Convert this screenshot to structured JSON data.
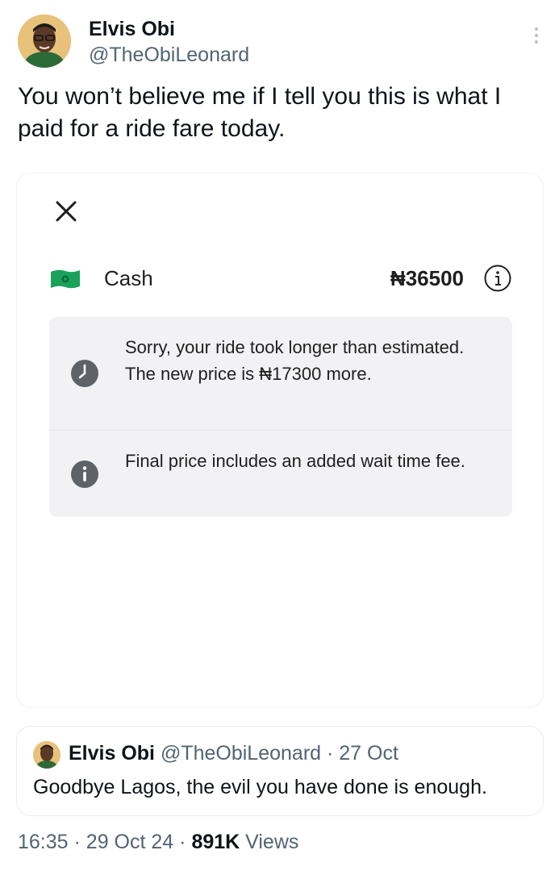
{
  "tweet": {
    "author": {
      "name": "Elvis Obi",
      "handle": "@TheObiLeonard"
    },
    "text": "You won’t believe me if I tell you this is what I paid for a ride fare today.",
    "icons": {
      "more": "more-vertical-icon"
    }
  },
  "receipt": {
    "icons": {
      "close": "close-icon",
      "cash": "cash-icon",
      "info": "info-icon",
      "clock": "clock-icon"
    },
    "payment_method": "Cash",
    "price": "₦36500",
    "notices": [
      {
        "icon": "clock-icon",
        "text": "Sorry, your ride took longer than estimated. The new price is ₦17300 more."
      },
      {
        "icon": "info-icon",
        "text": "Final price includes an added wait time fee."
      }
    ],
    "colors": {
      "cash_green": "#1aa25a",
      "notice_bg": "#f2f2f4",
      "icon_gray": "#5f6368"
    }
  },
  "quoted_tweet": {
    "name": "Elvis Obi",
    "handle": "@TheObiLeonard",
    "separator": "·",
    "date": "27 Oct",
    "text": "Goodbye Lagos, the evil you have done is enough."
  },
  "footer": {
    "time": "16:35",
    "separator": "·",
    "date": "29 Oct 24",
    "views_count": "891K",
    "views_label": "Views"
  }
}
